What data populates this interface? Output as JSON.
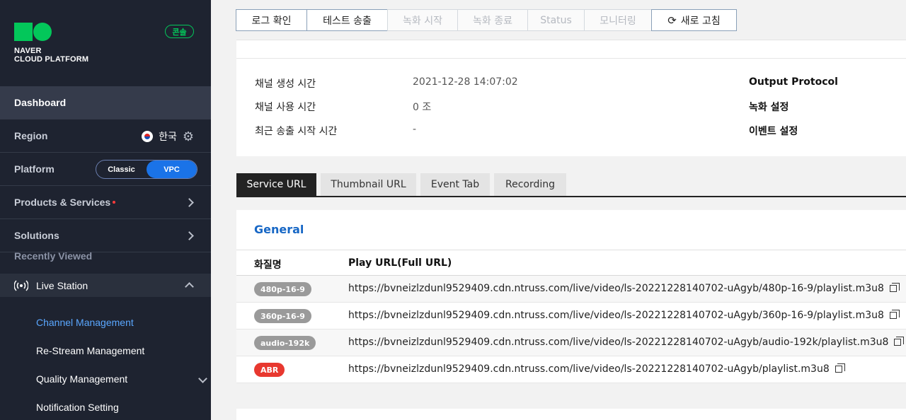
{
  "sidebar": {
    "logo_line1": "NAVER",
    "logo_line2": "CLOUD PLATFORM",
    "console_badge": "콘솔",
    "dashboard": "Dashboard",
    "region_label": "Region",
    "region_value": "한국",
    "platform_label": "Platform",
    "platform_options": [
      "Classic",
      "VPC"
    ],
    "platform_selected": "VPC",
    "products": "Products & Services",
    "solutions": "Solutions",
    "recently_viewed": "Recently Viewed",
    "live_station": "Live Station",
    "sub_items": [
      "Channel Management",
      "Re-Stream Management",
      "Quality Management",
      "Notification Setting"
    ]
  },
  "toolbar": {
    "buttons": [
      "로그 확인",
      "테스트 송출",
      "녹화 시작",
      "녹화 종료",
      "Status",
      "모니터링",
      "새로 고침"
    ]
  },
  "info": {
    "rows": [
      {
        "label": "채널 생성 시간",
        "value": "2021-12-28 14:07:02",
        "right": "Output Protocol"
      },
      {
        "label": "채널 사용 시간",
        "value": "0 조",
        "right": "녹화 설정"
      },
      {
        "label": "최근 송출 시작 시간",
        "value": "-",
        "right": "이벤트 설정"
      }
    ]
  },
  "tabs": [
    "Service URL",
    "Thumbnail URL",
    "Event Tab",
    "Recording"
  ],
  "general": {
    "title": "General",
    "col_quality": "화질명",
    "col_url": "Play URL(Full URL)",
    "rows": [
      {
        "quality": "480p-16-9",
        "url": "https://bvneizlzdunl9529409.cdn.ntruss.com/live/video/ls-20221228140702-uAgyb/480p-16-9/playlist.m3u8"
      },
      {
        "quality": "360p-16-9",
        "url": "https://bvneizlzdunl9529409.cdn.ntruss.com/live/video/ls-20221228140702-uAgyb/360p-16-9/playlist.m3u8"
      },
      {
        "quality": "audio-192k",
        "url": "https://bvneizlzdunl9529409.cdn.ntruss.com/live/video/ls-20221228140702-uAgyb/audio-192k/playlist.m3u8"
      },
      {
        "quality": "ABR",
        "url": "https://bvneizlzdunl9529409.cdn.ntruss.com/live/video/ls-20221228140702-uAgyb/playlist.m3u8"
      }
    ]
  },
  "colors": {
    "accent": "#1a73e8",
    "naver_green": "#03c75a",
    "abr_red": "#e8382f",
    "title_blue": "#1767c5"
  },
  "icons": [
    "naver-logo-icon",
    "flag-korea-icon",
    "gear-icon",
    "chevron-right-icon",
    "chevron-up-icon",
    "chevron-down-icon",
    "live-station-icon",
    "refresh-icon",
    "copy-icon"
  ]
}
